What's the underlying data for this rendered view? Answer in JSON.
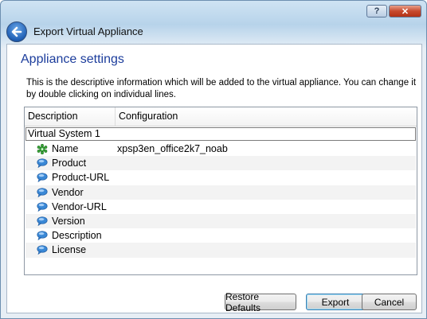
{
  "window": {
    "title": "Export Virtual Appliance",
    "help_label": "?",
    "close_label": "✕"
  },
  "page": {
    "title": "Appliance settings",
    "description": "This is the descriptive information which will be added to the virtual appliance. You can change it by double clicking on individual lines."
  },
  "table": {
    "headers": [
      "Description",
      "Configuration"
    ],
    "group": "Virtual System 1",
    "rows": [
      {
        "label": "Name",
        "value": "xpsp3en_office2k7_noab",
        "icon": "green-gear-icon"
      },
      {
        "label": "Product",
        "value": "",
        "icon": "speech-bubble-icon"
      },
      {
        "label": "Product-URL",
        "value": "",
        "icon": "speech-bubble-icon"
      },
      {
        "label": "Vendor",
        "value": "",
        "icon": "speech-bubble-icon"
      },
      {
        "label": "Vendor-URL",
        "value": "",
        "icon": "speech-bubble-icon"
      },
      {
        "label": "Version",
        "value": "",
        "icon": "speech-bubble-icon"
      },
      {
        "label": "Description",
        "value": "",
        "icon": "speech-bubble-icon"
      },
      {
        "label": "License",
        "value": "",
        "icon": "speech-bubble-icon"
      }
    ]
  },
  "buttons": {
    "restore": "Restore Defaults",
    "export": "Export",
    "cancel": "Cancel"
  },
  "colors": {
    "title_text": "#1c3d9c",
    "bubble": "#3a88d6",
    "gear": "#3aa83a"
  }
}
